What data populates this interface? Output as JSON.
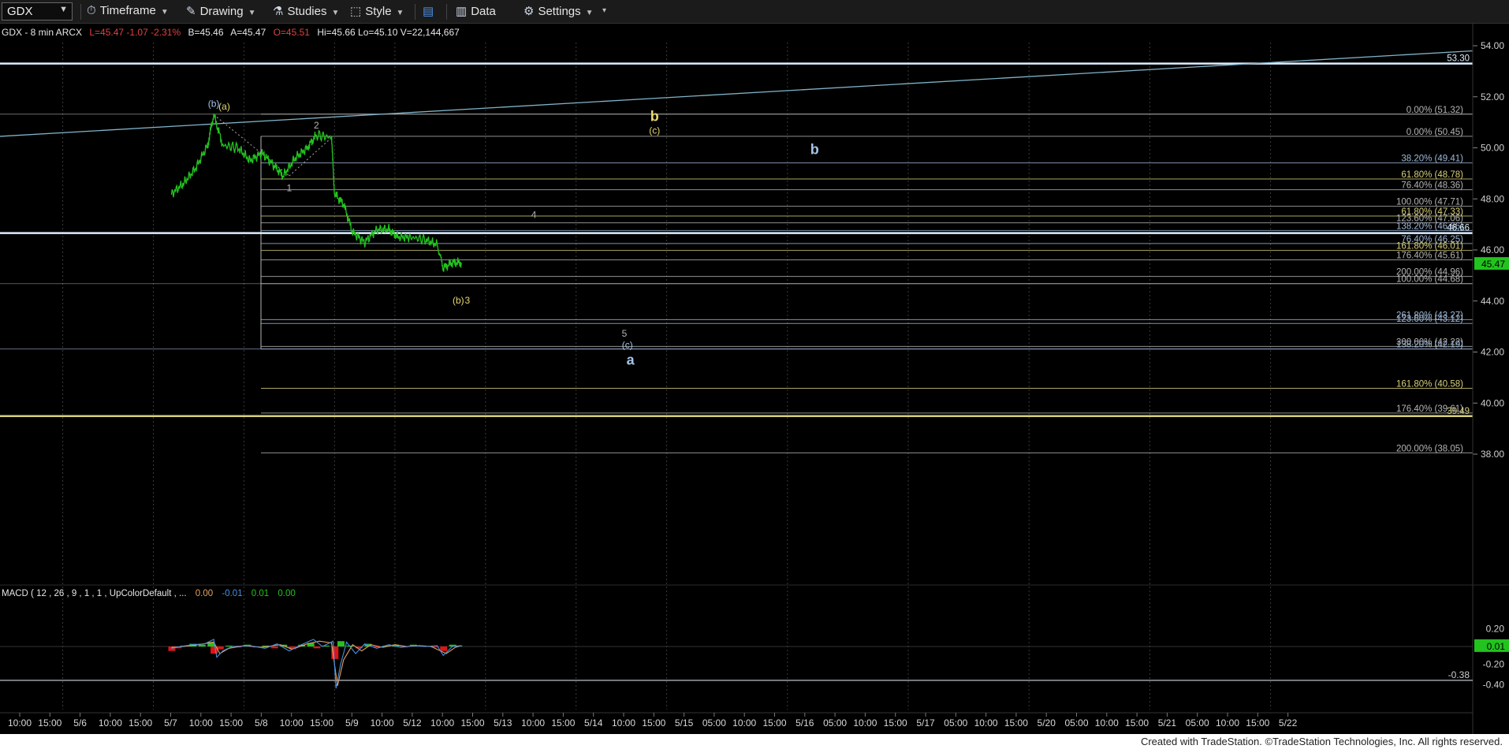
{
  "toolbar": {
    "symbol": "GDX",
    "items": [
      {
        "label": "Timeframe",
        "icon": "clock-icon"
      },
      {
        "label": "Drawing",
        "icon": "pencil-icon"
      },
      {
        "label": "Studies",
        "icon": "flask-icon"
      },
      {
        "label": "Style",
        "icon": "style-icon"
      },
      {
        "label": "",
        "icon": "layout-icon"
      },
      {
        "label": "Data",
        "icon": "bar-chart-icon"
      },
      {
        "label": "Settings",
        "icon": "gear-icon"
      }
    ]
  },
  "header": {
    "base": "GDX - 8 min  ARCX",
    "quote": "L=45.47  -1.07  -2.31%",
    "bid": "B=45.46",
    "ask": "A=45.47",
    "open": "O=45.51",
    "rest": "Hi=45.66  Lo=45.10  V=22,144,667"
  },
  "macd_label": {
    "base": "MACD ( 12 , 26 , 9 , 1 , 1 , UpColorDefault , ...",
    "v1": "0.00",
    "v2": "-0.01",
    "v3": "0.01",
    "v4": "0.00"
  },
  "footer": "Created with TradeStation. ©TradeStation Technologies, Inc. All rights reserved.",
  "colors": {
    "price": "#22c31e",
    "fib_gray": "#b4b4b4",
    "fib_blue": "#9fb8d8",
    "fib_yellow": "#d8d07a",
    "label_yellow": "#e8d870",
    "label_blue": "#a7c3e6",
    "trend": "#7fb3c8",
    "macd_up": "#22c31e",
    "macd_down": "#e01414",
    "macd_line": "#4a8fe0",
    "signal_line": "#e8a060"
  },
  "chart_data": {
    "type": "line",
    "title": "GDX - 8 min",
    "ylim": [
      37,
      54
    ],
    "price_ticks": [
      "54.00",
      "52.00",
      "50.00",
      "48.00",
      "46.00",
      "44.00",
      "42.00",
      "40.00",
      "38.00"
    ],
    "current_price": "45.47",
    "x_axis_labels": [
      "10:00",
      "15:00",
      "5/6",
      "10:00",
      "15:00",
      "5/7",
      "10:00",
      "15:00",
      "5/8",
      "10:00",
      "15:00",
      "5/9",
      "10:00",
      "5/12",
      "10:00",
      "15:00",
      "5/13",
      "10:00",
      "15:00",
      "5/14",
      "10:00",
      "15:00",
      "5/15",
      "05:00",
      "10:00",
      "15:00",
      "5/16",
      "05:00",
      "10:00",
      "15:00",
      "5/17",
      "05:00",
      "10:00",
      "15:00",
      "5/20",
      "05:00",
      "10:00",
      "15:00",
      "5/21",
      "05:00",
      "10:00",
      "15:00",
      "5/22"
    ],
    "series": [
      {
        "name": "Price",
        "points": [
          [
            5.6,
            48.2
          ],
          [
            6.0,
            48.6
          ],
          [
            6.4,
            49.2
          ],
          [
            6.8,
            50.1
          ],
          [
            7.0,
            51.3
          ],
          [
            7.3,
            50.1
          ],
          [
            7.8,
            50.0
          ],
          [
            8.2,
            49.5
          ],
          [
            8.6,
            49.8
          ],
          [
            9.0,
            49.3
          ],
          [
            9.3,
            48.9
          ],
          [
            9.7,
            49.6
          ],
          [
            10.1,
            50.0
          ],
          [
            10.4,
            50.5
          ],
          [
            10.9,
            50.4
          ],
          [
            11.0,
            48.2
          ],
          [
            11.3,
            47.8
          ],
          [
            11.6,
            46.7
          ],
          [
            12.0,
            46.3
          ],
          [
            12.4,
            46.8
          ],
          [
            12.8,
            46.8
          ],
          [
            13.1,
            46.5
          ],
          [
            13.5,
            46.5
          ],
          [
            14.0,
            46.4
          ],
          [
            14.4,
            46.2
          ],
          [
            14.6,
            45.3
          ],
          [
            14.9,
            45.5
          ],
          [
            15.2,
            45.5
          ]
        ]
      }
    ],
    "fib_levels": [
      {
        "label": "0.00% (51.32)",
        "value": 51.32,
        "color": "gray"
      },
      {
        "label": "0.00% (50.45)",
        "value": 50.45,
        "color": "gray"
      },
      {
        "label": "38.20% (49.41)",
        "value": 49.41,
        "color": "blue"
      },
      {
        "label": "61.80% (48.78)",
        "value": 48.78,
        "color": "yellow"
      },
      {
        "label": "76.40% (48.36)",
        "value": 48.36,
        "color": "gray"
      },
      {
        "label": "100.00% (47.71)",
        "value": 47.71,
        "color": "gray"
      },
      {
        "label": "61.80% (47.33)",
        "value": 47.33,
        "color": "yellow"
      },
      {
        "label": "123.60% (47.06)",
        "value": 47.06,
        "color": "gray"
      },
      {
        "label": "138.20% (46.66)",
        "value": 46.76,
        "color": "blue"
      },
      {
        "label": "76.40% (46.25)",
        "value": 46.25,
        "color": "blue"
      },
      {
        "label": "161.80% (46.01)",
        "value": 45.98,
        "color": "yellow"
      },
      {
        "label": "176.40% (45.61)",
        "value": 45.61,
        "color": "gray"
      },
      {
        "label": "200.00% (44.96)",
        "value": 44.96,
        "color": "gray"
      },
      {
        "label": "100.00% (44.68)",
        "value": 44.68,
        "color": "gray"
      },
      {
        "label": "261.80% (43.27)",
        "value": 43.27,
        "color": "blue"
      },
      {
        "label": "123.60% (43.12)",
        "value": 43.12,
        "color": "blue"
      },
      {
        "label": "300.00% (42.22)",
        "value": 42.22,
        "color": "gray"
      },
      {
        "label": "138.20% (42.19)",
        "value": 42.12,
        "color": "blue"
      },
      {
        "label": "161.80% (40.58)",
        "value": 40.58,
        "color": "yellow"
      },
      {
        "label": "176.40% (39.61)",
        "value": 39.61,
        "color": "gray"
      },
      {
        "label": "200.00% (38.05)",
        "value": 38.05,
        "color": "gray"
      }
    ],
    "horizontal_lines": [
      {
        "label": "53.30",
        "value": 53.3
      },
      {
        "label": "46.66",
        "value": 46.66
      },
      {
        "label": "39.49",
        "value": 39.49
      }
    ],
    "wave_labels": [
      {
        "text": "(b)",
        "x": 7.0,
        "y": 51.6,
        "color": "blue"
      },
      {
        "text": "(a)",
        "x": 7.35,
        "y": 51.5,
        "color": "yellow"
      },
      {
        "text": "2",
        "x": 10.4,
        "y": 50.75,
        "color": "gray"
      },
      {
        "text": "1",
        "x": 9.5,
        "y": 48.3,
        "color": "gray"
      },
      {
        "text": "4",
        "x": 17.6,
        "y": 47.25,
        "color": "gray"
      },
      {
        "text": "(b)",
        "x": 15.1,
        "y": 43.9,
        "color": "yellow"
      },
      {
        "text": "3",
        "x": 15.4,
        "y": 43.9,
        "color": "yellow"
      },
      {
        "text": "5",
        "x": 20.6,
        "y": 42.6,
        "color": "gray"
      },
      {
        "text": "(c)",
        "x": 20.7,
        "y": 42.15,
        "color": "blue"
      },
      {
        "text": "a",
        "x": 20.8,
        "y": 41.5,
        "color": "blue"
      },
      {
        "text": "b",
        "x": 21.6,
        "y": 51.05,
        "color": "yellow"
      },
      {
        "text": "(c)",
        "x": 21.6,
        "y": 50.55,
        "color": "yellow"
      },
      {
        "text": "b",
        "x": 26.9,
        "y": 49.75,
        "color": "blue"
      }
    ],
    "macd": {
      "ylim": [
        -0.5,
        0.3
      ],
      "ticks": [
        "0.20",
        "0.01",
        "-0.20",
        "-0.38",
        "-0.40"
      ],
      "level_line": -0.38,
      "hist": [
        [
          5.6,
          -0.05
        ],
        [
          5.8,
          -0.02
        ],
        [
          6.0,
          0.01
        ],
        [
          6.3,
          0.03
        ],
        [
          6.6,
          0.02
        ],
        [
          6.9,
          0.05
        ],
        [
          7.0,
          -0.08
        ],
        [
          7.2,
          -0.03
        ],
        [
          7.5,
          0.01
        ],
        [
          7.8,
          -0.01
        ],
        [
          8.1,
          0.02
        ],
        [
          8.4,
          -0.01
        ],
        [
          8.7,
          0.01
        ],
        [
          9.0,
          -0.02
        ],
        [
          9.3,
          0.02
        ],
        [
          9.6,
          -0.03
        ],
        [
          9.9,
          0.02
        ],
        [
          10.2,
          0.04
        ],
        [
          10.4,
          -0.02
        ],
        [
          10.7,
          0.01
        ],
        [
          11.0,
          -0.14
        ],
        [
          11.2,
          0.06
        ],
        [
          11.5,
          0.01
        ],
        [
          11.8,
          -0.02
        ],
        [
          12.1,
          0.03
        ],
        [
          12.4,
          -0.01
        ],
        [
          12.7,
          0.01
        ],
        [
          13.0,
          0.02
        ],
        [
          13.3,
          -0.01
        ],
        [
          13.6,
          0.02
        ],
        [
          13.9,
          0.01
        ],
        [
          14.3,
          -0.01
        ],
        [
          14.6,
          -0.05
        ],
        [
          14.9,
          0.02
        ],
        [
          15.1,
          0.01
        ]
      ],
      "macd_line": [
        [
          5.6,
          -0.02
        ],
        [
          5.9,
          0.0
        ],
        [
          6.3,
          0.02
        ],
        [
          6.7,
          0.03
        ],
        [
          7.0,
          0.08
        ],
        [
          7.1,
          -0.12
        ],
        [
          7.3,
          -0.05
        ],
        [
          7.6,
          0.0
        ],
        [
          8.2,
          0.01
        ],
        [
          8.7,
          -0.02
        ],
        [
          9.1,
          0.03
        ],
        [
          9.5,
          -0.05
        ],
        [
          9.9,
          0.02
        ],
        [
          10.3,
          0.08
        ],
        [
          10.6,
          0.0
        ],
        [
          10.95,
          0.06
        ],
        [
          11.05,
          -0.47
        ],
        [
          11.2,
          -0.2
        ],
        [
          11.4,
          0.05
        ],
        [
          11.7,
          -0.08
        ],
        [
          12.0,
          0.03
        ],
        [
          12.4,
          -0.02
        ],
        [
          12.8,
          0.02
        ],
        [
          13.2,
          -0.01
        ],
        [
          13.6,
          0.01
        ],
        [
          14.0,
          0.0
        ],
        [
          14.4,
          0.01
        ],
        [
          14.6,
          -0.1
        ],
        [
          14.9,
          0.0
        ],
        [
          15.2,
          0.01
        ]
      ],
      "signal_line": [
        [
          5.6,
          -0.01
        ],
        [
          6.0,
          0.0
        ],
        [
          6.5,
          0.02
        ],
        [
          7.0,
          0.05
        ],
        [
          7.2,
          -0.08
        ],
        [
          7.5,
          -0.02
        ],
        [
          8.0,
          0.01
        ],
        [
          8.6,
          -0.01
        ],
        [
          9.2,
          0.02
        ],
        [
          9.6,
          -0.03
        ],
        [
          10.1,
          0.03
        ],
        [
          10.5,
          0.06
        ],
        [
          10.9,
          0.04
        ],
        [
          11.1,
          -0.44
        ],
        [
          11.3,
          -0.15
        ],
        [
          11.6,
          0.02
        ],
        [
          11.9,
          -0.05
        ],
        [
          12.2,
          0.02
        ],
        [
          12.6,
          -0.01
        ],
        [
          13.0,
          0.02
        ],
        [
          13.4,
          0.0
        ],
        [
          13.8,
          0.01
        ],
        [
          14.2,
          0.0
        ],
        [
          14.7,
          -0.08
        ],
        [
          15.0,
          -0.01
        ],
        [
          15.2,
          0.01
        ]
      ]
    }
  }
}
